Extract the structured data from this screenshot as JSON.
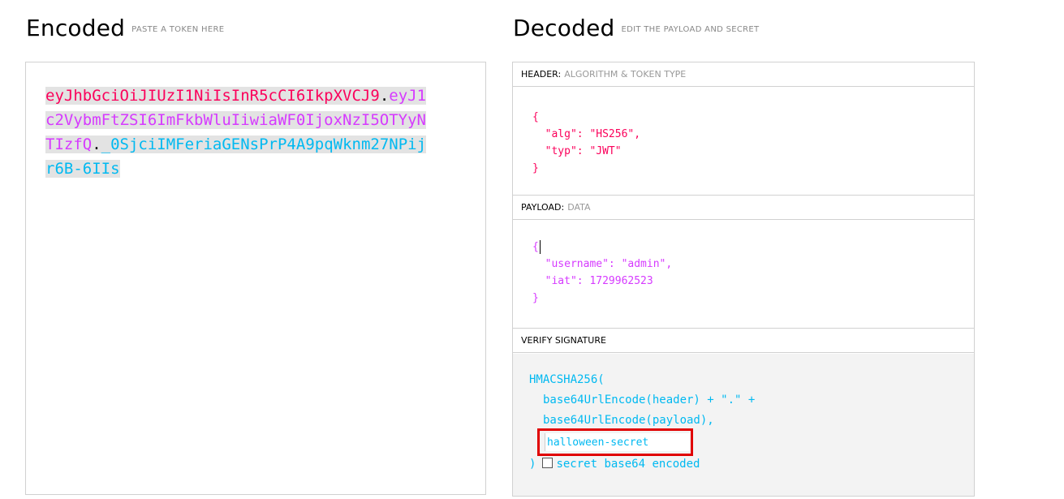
{
  "encoded": {
    "title": "Encoded",
    "subtitle": "PASTE A TOKEN HERE",
    "token": {
      "header": "eyJhbGciOiJIUzI1NiIsInR5cCI6IkpXVCJ9",
      "payload": "eyJ1c2VybmFtZSI6ImFkbWluIiwiaWF0IjoxNzI5OTYyNTIzfQ",
      "signature": "_0SjciIMFeriaGENsPrP4A9pqWknm27NPijr6B-6IIs",
      "dot": "."
    }
  },
  "decoded": {
    "title": "Decoded",
    "subtitle": "EDIT THE PAYLOAD AND SECRET",
    "header": {
      "label": "HEADER:",
      "label_sub": "ALGORITHM & TOKEN TYPE",
      "lines": [
        "{",
        "  \"alg\": \"HS256\",",
        "  \"typ\": \"JWT\"",
        "}"
      ]
    },
    "payload": {
      "label": "PAYLOAD:",
      "label_sub": "DATA",
      "lines": [
        "{",
        "  \"username\": \"admin\",",
        "  \"iat\": 1729962523",
        "}"
      ]
    },
    "signature": {
      "label": "VERIFY SIGNATURE",
      "line1": "HMACSHA256(",
      "line2": "base64UrlEncode(header) + \".\" +",
      "line3": "base64UrlEncode(payload),",
      "secret_value": "halloween-secret",
      "close": ")",
      "checkbox_label": "secret base64 encoded"
    }
  },
  "colors": {
    "header": "#fb015b",
    "payload": "#d63aff",
    "signature": "#00b9f1",
    "highlight_box": "#e00000"
  }
}
